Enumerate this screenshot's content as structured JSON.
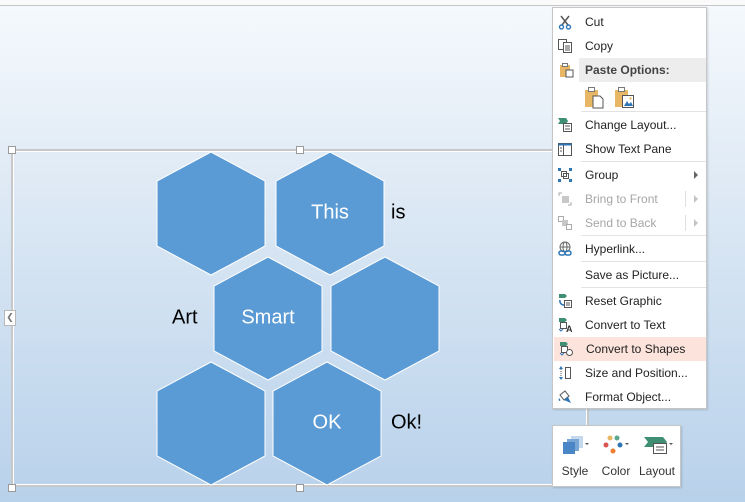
{
  "smartart": {
    "hexagons": [
      {
        "id": "hex-1",
        "label": ""
      },
      {
        "id": "hex-2",
        "label": "This"
      },
      {
        "id": "hex-3",
        "label": "Smart"
      },
      {
        "id": "hex-4",
        "label": ""
      },
      {
        "id": "hex-5",
        "label": ""
      },
      {
        "id": "hex-6",
        "label": "OK"
      }
    ],
    "side_labels": {
      "is": "is",
      "art": "Art",
      "ok": "Ok!"
    },
    "fill_color": "#5b9bd5",
    "collapse_icon": "chevron-left-icon"
  },
  "context_menu": {
    "items": [
      {
        "label": "Cut",
        "icon": "scissors-icon"
      },
      {
        "label": "Copy",
        "icon": "copy-icon"
      },
      {
        "label": "Paste Options:",
        "icon": "paste-icon"
      },
      {
        "label": "Change Layout...",
        "icon": "change-layout-icon"
      },
      {
        "label": "Show Text Pane",
        "icon": "text-pane-icon"
      },
      {
        "label": "Group",
        "icon": "group-icon"
      },
      {
        "label": "Bring to Front",
        "icon": "bring-to-front-icon",
        "disabled": true
      },
      {
        "label": "Send to Back",
        "icon": "send-to-back-icon",
        "disabled": true
      },
      {
        "label": "Hyperlink...",
        "icon": "hyperlink-icon"
      },
      {
        "label": "Save as Picture...",
        "icon": ""
      },
      {
        "label": "Reset Graphic",
        "icon": "reset-graphic-icon"
      },
      {
        "label": "Convert to Text",
        "icon": "convert-to-text-icon"
      },
      {
        "label": "Convert to Shapes",
        "icon": "convert-to-shapes-icon",
        "highlighted": true
      },
      {
        "label": "Size and Position...",
        "icon": "size-position-icon"
      },
      {
        "label": "Format Object...",
        "icon": "format-object-icon"
      }
    ],
    "paste_options": [
      "paste-keep-source-icon",
      "paste-picture-icon"
    ],
    "highlight_color": "#fce4dc"
  },
  "mini_toolbar": {
    "buttons": [
      {
        "label": "Style",
        "icon": "style-icon"
      },
      {
        "label": "Color",
        "icon": "color-icon"
      },
      {
        "label": "Layout",
        "icon": "layout-icon"
      }
    ]
  }
}
